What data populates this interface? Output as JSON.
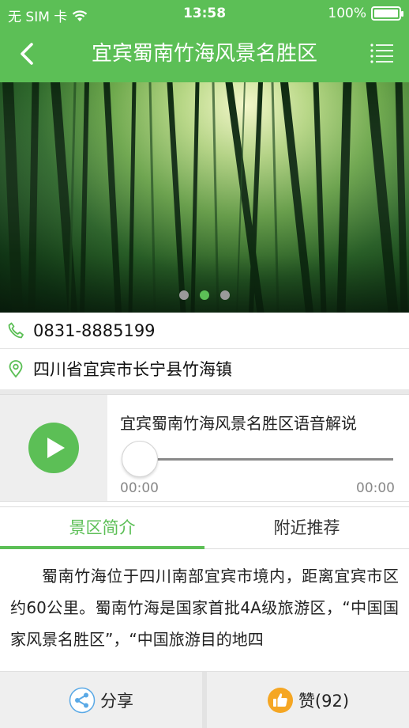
{
  "status_bar": {
    "carrier": "无 SIM 卡",
    "time": "13:58",
    "battery_percent": "100%",
    "wifi_icon": "wifi-icon",
    "battery_level": 1.0
  },
  "nav": {
    "title": "宜宾蜀南竹海风景名胜区",
    "back_icon": "chevron-left-icon",
    "menu_icon": "list-menu-icon"
  },
  "banner": {
    "slide_count": 3,
    "active_index": 1
  },
  "contact": {
    "phone": "0831-8885199",
    "address": "四川省宜宾市长宁县竹海镇",
    "phone_icon": "phone-icon",
    "location_icon": "location-pin-icon"
  },
  "audio": {
    "title": "宜宾蜀南竹海风景名胜区语音解说",
    "current_time": "00:00",
    "total_time": "00:00",
    "progress": 0
  },
  "tabs": [
    {
      "label": "景区简介",
      "active": true
    },
    {
      "label": "附近推荐",
      "active": false
    }
  ],
  "intro": {
    "text": "蜀南竹海位于四川南部宜宾市境内，距离宜宾市区约60公里。蜀南竹海是国家首批4A级旅游区，“中国国家风景名胜区”，“中国旅游目的地四"
  },
  "bottom_bar": {
    "share_label": "分享",
    "like_label": "赞(92)",
    "share_icon": "share-icon",
    "like_icon": "thumbs-up-icon"
  },
  "colors": {
    "accent": "#5cbf56",
    "like_icon": "#f5a623",
    "share_icon": "#5aa9e6"
  }
}
